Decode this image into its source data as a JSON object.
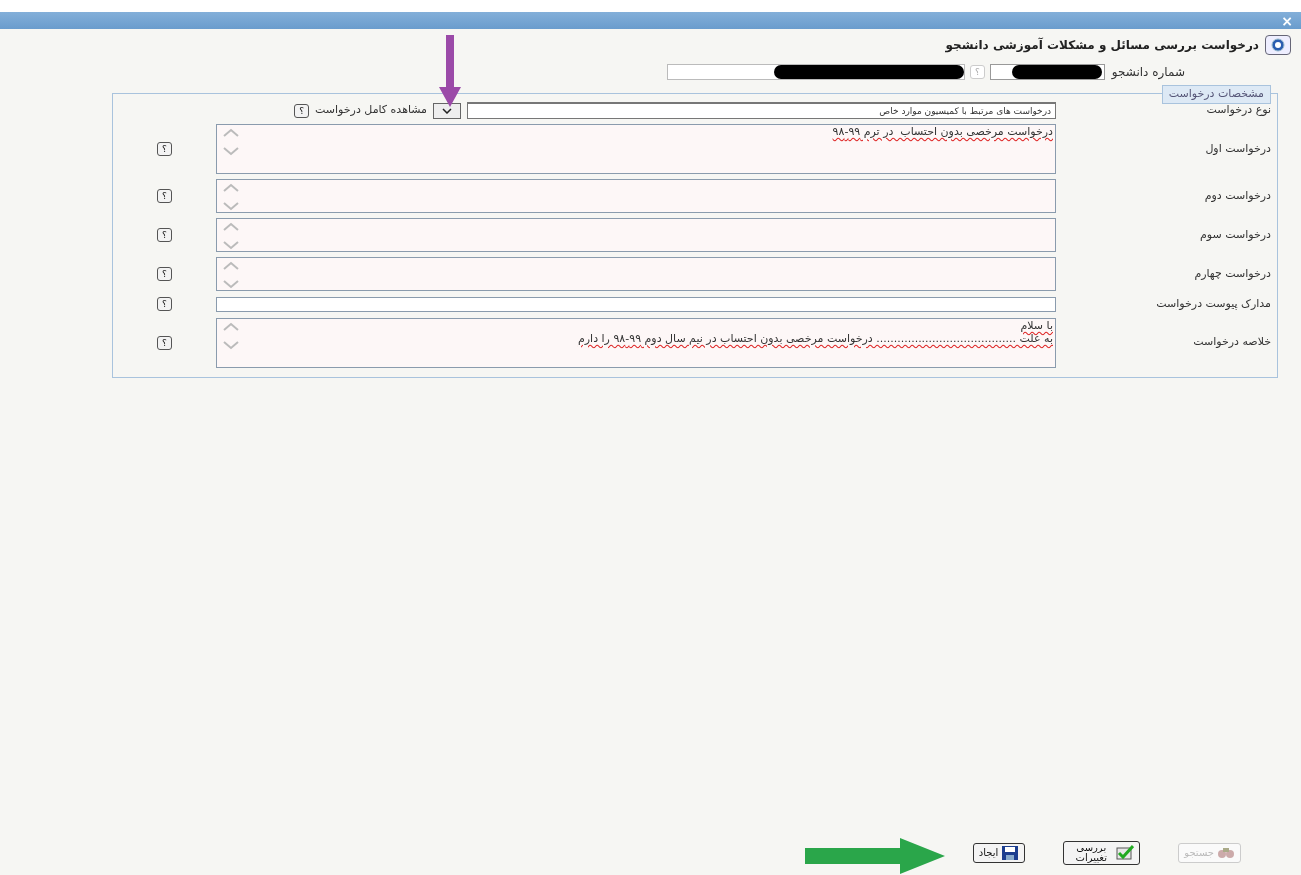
{
  "window": {
    "close": "×"
  },
  "header": {
    "title": "درخواست بررسی مسائل و مشکلات آموزشی دانشجو"
  },
  "student": {
    "label": "شماره دانشجو",
    "help": "؟"
  },
  "section": {
    "legend": "مشخصات درخواست"
  },
  "request_type": {
    "label": "نوع درخواست",
    "value": "درخواست های مرتبط با کمیسیون موارد خاص",
    "view_full": "مشاهده کامل درخواست",
    "help": "؟"
  },
  "fields": [
    {
      "kind": "textarea",
      "label": "درخواست اول",
      "lines": [
        "درخواست مرخصی بدون احتساب  در ترم ۹۹-۹۸"
      ],
      "help": "؟"
    },
    {
      "kind": "textarea",
      "label": "درخواست دوم",
      "help": "؟"
    },
    {
      "kind": "textarea",
      "label": "درخواست سوم",
      "help": "؟"
    },
    {
      "kind": "textarea",
      "label": "درخواست چهارم",
      "help": "؟"
    },
    {
      "kind": "input",
      "label": "مدارک پیوست درخواست",
      "help": "؟"
    },
    {
      "kind": "textarea",
      "label": "خلاصه درخواست",
      "lines": [
        "با سلام",
        "به علت ........................................ درخواست مرخصی بدون احتساب در نیم سال دوم ۹۹-۹۸ را دارم"
      ],
      "help": "؟"
    }
  ],
  "buttons": [
    {
      "kind": "search",
      "label": "جستجو",
      "disabled": true
    },
    {
      "kind": "review",
      "label": "بررسی تغییرات",
      "disabled": false
    },
    {
      "kind": "create",
      "label": "ایجاد",
      "disabled": false
    }
  ]
}
